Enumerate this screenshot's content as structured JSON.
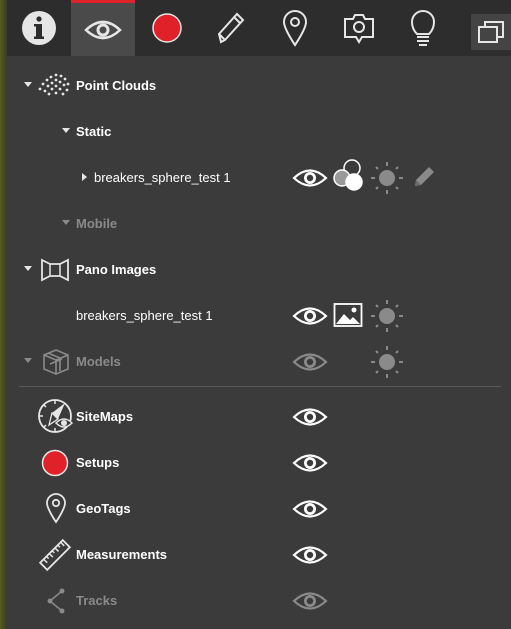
{
  "colors": {
    "accent": "#e0212a",
    "background": "#3b3b3b",
    "toolbar": "#2d2d2d",
    "dim": "#8a8a8a"
  },
  "toolbar": {
    "tabs": [
      {
        "icon": "info-icon"
      },
      {
        "icon": "eye-icon",
        "active": true
      },
      {
        "icon": "record-icon"
      },
      {
        "icon": "pencil-icon"
      },
      {
        "icon": "map-pin-icon"
      },
      {
        "icon": "camera-icon"
      },
      {
        "icon": "lightbulb-icon"
      }
    ],
    "panel_button": {
      "icon": "windows-icon"
    }
  },
  "tree": {
    "point_clouds": {
      "label": "Point Clouds",
      "static": {
        "label": "Static",
        "items": [
          {
            "label": "breakers_sphere_test 1"
          }
        ]
      },
      "mobile": {
        "label": "Mobile"
      }
    },
    "pano_images": {
      "label": "Pano Images",
      "items": [
        {
          "label": "breakers_sphere_test 1"
        }
      ]
    },
    "models": {
      "label": "Models"
    },
    "sitemaps": {
      "label": "SiteMaps"
    },
    "setups": {
      "label": "Setups"
    },
    "geotags": {
      "label": "GeoTags"
    },
    "measurements": {
      "label": "Measurements"
    },
    "tracks": {
      "label": "Tracks"
    }
  }
}
